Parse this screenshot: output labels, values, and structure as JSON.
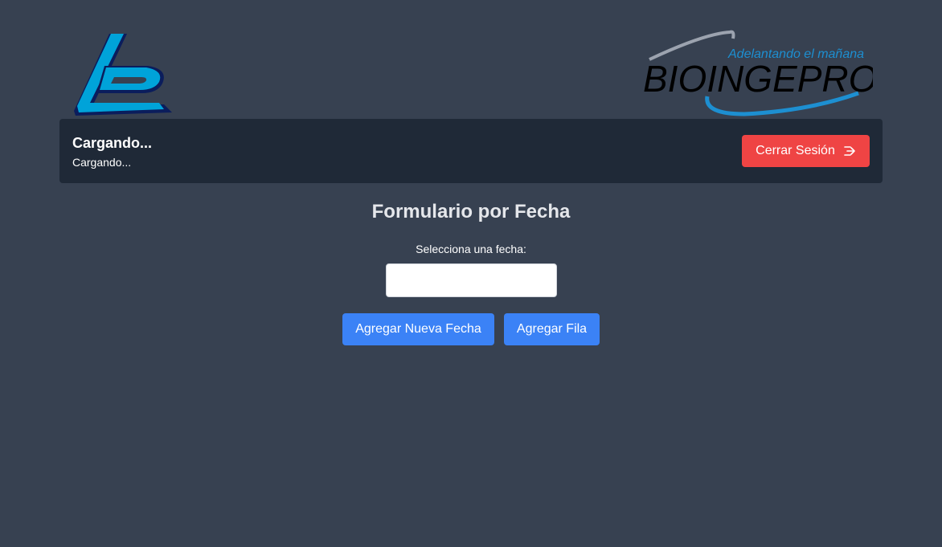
{
  "logos": {
    "left_brand": "LB",
    "right_brand": "BIOINGEPRO",
    "right_tagline": "Adelantando el mañana"
  },
  "header": {
    "user_name": "Cargando...",
    "user_detail": "Cargando...",
    "logout_label": "Cerrar Sesión",
    "logout_icon": "logout-arrow-icon"
  },
  "form": {
    "title": "Formulario por Fecha",
    "date_label": "Selecciona una fecha:",
    "date_value": "",
    "add_date_label": "Agregar Nueva Fecha",
    "add_row_label": "Agregar Fila"
  },
  "colors": {
    "background": "#374151",
    "header_bar": "#1f2937",
    "logout_button": "#ef4444",
    "primary_button": "#3b82f6"
  }
}
